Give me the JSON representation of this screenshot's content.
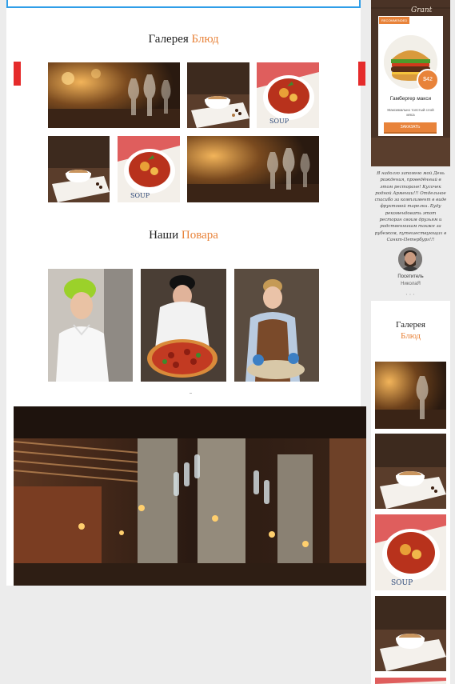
{
  "gallery": {
    "title_main": "Галерея",
    "title_accent": "Блюд",
    "images": [
      {
        "name": "glasses-table-photo"
      },
      {
        "name": "coffee-cup-photo"
      },
      {
        "name": "soup-bowl-photo"
      },
      {
        "name": "coffee-cup-photo"
      },
      {
        "name": "soup-bowl-photo"
      },
      {
        "name": "glasses-table-photo"
      }
    ]
  },
  "chefs": {
    "title_main": "Наши",
    "title_accent": "Повара",
    "images": [
      {
        "name": "chef-woman-photo"
      },
      {
        "name": "chef-pizza-photo"
      },
      {
        "name": "chef-cooking-photo"
      }
    ]
  },
  "promo": {
    "brand": "Grant",
    "badge": "RECOMMENDED",
    "price": "$42",
    "name": "Гамбергер макси",
    "description": "Максимально толстый слой мяса",
    "button": "ЗАКАЗАТЬ"
  },
  "testimonial": {
    "text": "Я надолго запомню мой День рождения, проведённый в этом ресторане! Кусочек родной Армении!!! Отдельное спасибо за комплимент в виде фруктовой тарелки. Буду рекомендовать этот ресторан своим друзьям и родственникам также за рубежом, путешествующих в Санкт-Петербург!!!",
    "role": "Посетитель",
    "name": "НиколаЯ",
    "dots": "• • •"
  },
  "side_gallery": {
    "title_main": "Галерея",
    "title_accent": "Блюд"
  },
  "colors": {
    "accent": "#e8833a",
    "arrow": "#e52b2b",
    "top_border": "#2f9ee8"
  }
}
